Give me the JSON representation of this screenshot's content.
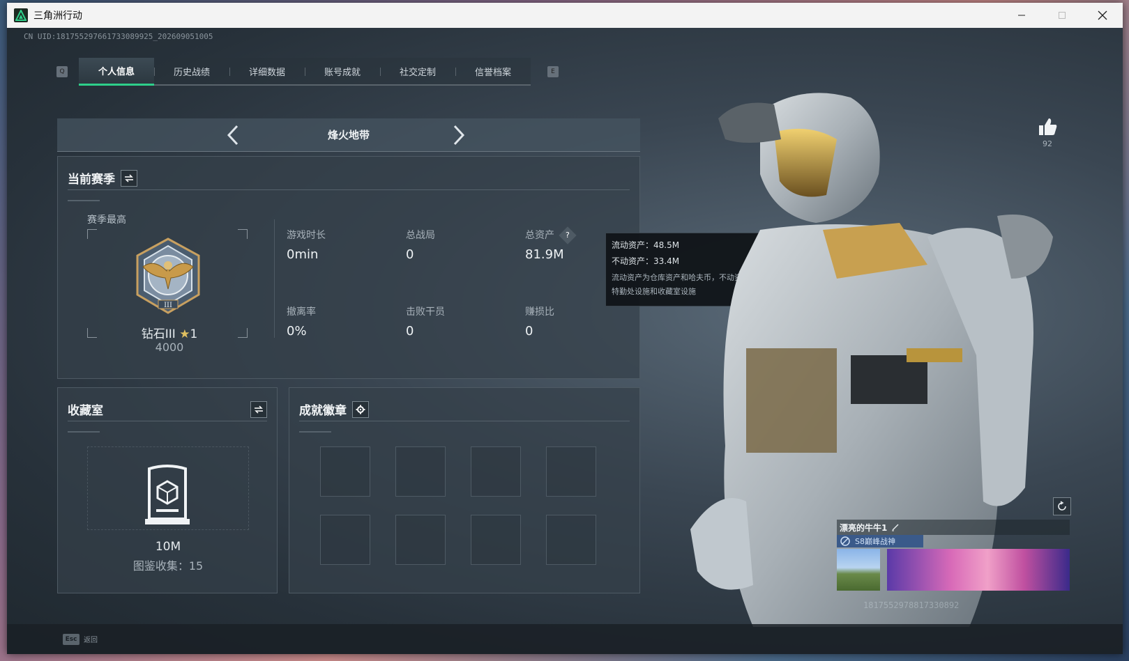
{
  "window": {
    "title": "三角洲行动"
  },
  "uid_line": "CN UID:181755297661733089925_202609051005",
  "tabs": {
    "left_key": "Q",
    "right_key": "E",
    "items": [
      {
        "label": "个人信息",
        "active": true
      },
      {
        "label": "历史战绩"
      },
      {
        "label": "详细数据"
      },
      {
        "label": "账号成就"
      },
      {
        "label": "社交定制"
      },
      {
        "label": "信誉档案"
      }
    ]
  },
  "mode": {
    "title": "烽火地带"
  },
  "season": {
    "title": "当前赛季",
    "best_label": "赛季最高",
    "rank_name": "钻石III",
    "rank_stars": "1",
    "rank_score": "4000",
    "stats": [
      {
        "label": "游戏时长",
        "value": "0min"
      },
      {
        "label": "总战局",
        "value": "0"
      },
      {
        "label": "总资产",
        "value": "81.9M",
        "help": "?"
      },
      {
        "label": "撤离率",
        "value": "0%"
      },
      {
        "label": "击败干员",
        "value": "0"
      },
      {
        "label": "赚损比",
        "value": "0"
      }
    ]
  },
  "tooltip": {
    "liquid": "流动资产：48.5M",
    "fixed": "不动资产：33.4M",
    "note_line1": "流动资产为仓库资产和哈夫币，不动资产为",
    "note_line2": "特勤处设施和收藏室设施"
  },
  "collection": {
    "title": "收藏室",
    "value": "10M",
    "count_label": "图鉴收集：15"
  },
  "badges": {
    "title": "成就徽章",
    "slots": 8
  },
  "like": {
    "count": "92"
  },
  "profile": {
    "name": "漂亮的牛牛1",
    "title": "S8巅峰战神",
    "uid_partial": "1817552978817330892"
  },
  "bottom": {
    "esc_key": "Esc",
    "esc_label": "返回"
  },
  "colors": {
    "accent": "#2ecf8a",
    "panel": "#34404a",
    "tooltip_bg": "#101418"
  }
}
